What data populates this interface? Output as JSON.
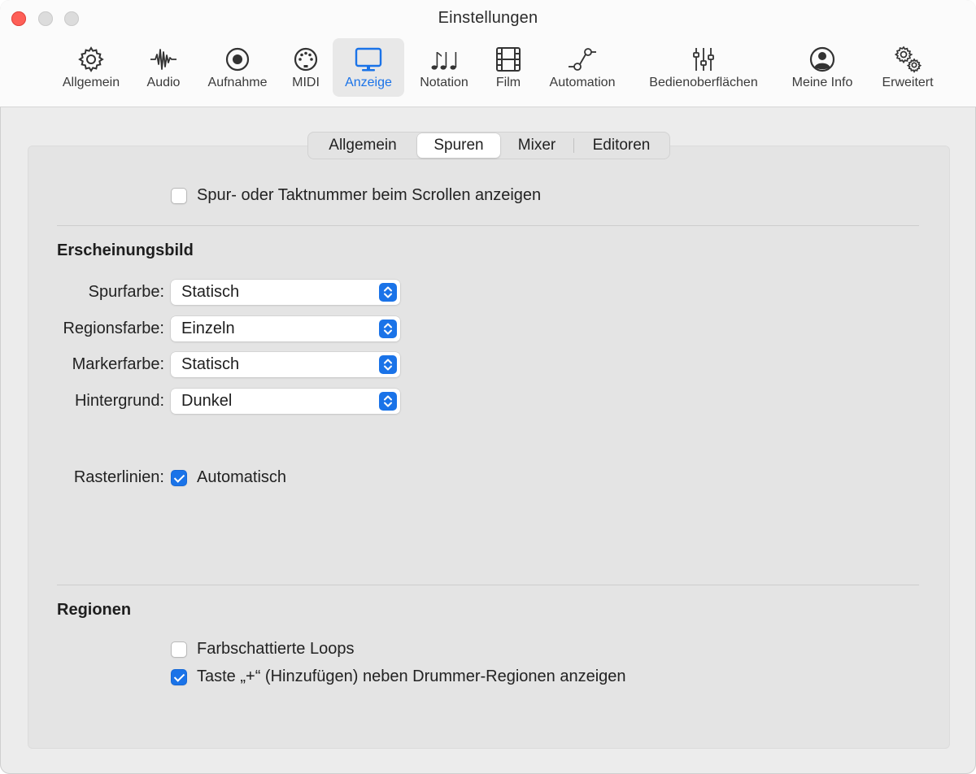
{
  "window": {
    "title": "Einstellungen"
  },
  "toolbar": {
    "items": [
      {
        "label": "Allgemein",
        "icon": "gear-icon"
      },
      {
        "label": "Audio",
        "icon": "waveform-icon"
      },
      {
        "label": "Aufnahme",
        "icon": "record-icon"
      },
      {
        "label": "MIDI",
        "icon": "midi-icon"
      },
      {
        "label": "Anzeige",
        "icon": "display-icon",
        "selected": true
      },
      {
        "label": "Notation",
        "icon": "notes-icon"
      },
      {
        "label": "Film",
        "icon": "film-icon"
      },
      {
        "label": "Automation",
        "icon": "automation-icon"
      },
      {
        "label": "Bedienoberflächen",
        "icon": "sliders-icon"
      },
      {
        "label": "Meine Info",
        "icon": "person-icon"
      },
      {
        "label": "Erweitert",
        "icon": "gears-icon"
      }
    ]
  },
  "tabs": {
    "items": [
      "Allgemein",
      "Spuren",
      "Mixer",
      "Editoren"
    ],
    "selected": "Spuren"
  },
  "options": {
    "scroll_number": {
      "label": "Spur- oder Taktnummer beim Scrollen anzeigen",
      "checked": false
    }
  },
  "appearance": {
    "heading": "Erscheinungsbild",
    "spurfarbe": {
      "label": "Spurfarbe:",
      "value": "Statisch"
    },
    "regionsfarbe": {
      "label": "Regionsfarbe:",
      "value": "Einzeln"
    },
    "markerfarbe": {
      "label": "Markerfarbe:",
      "value": "Statisch"
    },
    "hintergrund": {
      "label": "Hintergrund:",
      "value": "Dunkel"
    },
    "rasterlinien": {
      "label": "Rasterlinien:",
      "checkbox_label": "Automatisch",
      "checked": true
    }
  },
  "regions": {
    "heading": "Regionen",
    "loops": {
      "label": "Farbschattierte Loops",
      "checked": false
    },
    "drummer": {
      "label": "Taste „+“ (Hinzufügen) neben Drummer-Regionen anzeigen",
      "checked": true
    }
  },
  "colors": {
    "accent": "#1a73e8",
    "close": "#fe5f57"
  }
}
